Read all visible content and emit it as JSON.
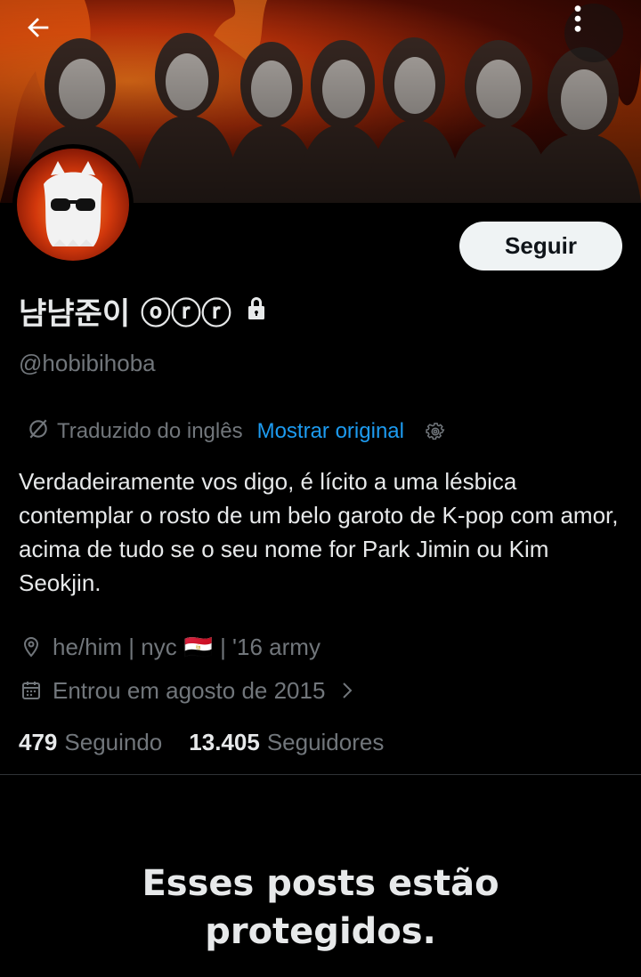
{
  "profile": {
    "display_name": "냠냠준이 ⓞⓡⓡ",
    "handle": "@hobibihoba",
    "follow_button_label": "Seguir",
    "locked": true
  },
  "translation": {
    "label": "Traduzido do inglês",
    "show_original_label": "Mostrar original"
  },
  "bio": "Verdadeiramente vos digo, é lícito a uma lésbica contemplar o rosto de um belo garoto de K-pop com amor, acima de tudo se o seu nome for Park Jimin ou Kim Seokjin.",
  "meta": {
    "location_prefix": "he/him | nyc",
    "location_flag": "🇪🇬",
    "location_suffix": "| '16 army",
    "joined": "Entrou em agosto de 2015"
  },
  "stats": {
    "following_count": "479",
    "following_label": "Seguindo",
    "followers_count": "13.405",
    "followers_label": "Seguidores"
  },
  "protected_message": "Esses posts estão protegidos.",
  "icons": {
    "back": "arrow-left-icon",
    "more": "more-vertical-icon",
    "lock": "lock-icon",
    "translate": "translate-icon",
    "settings": "gear-icon",
    "location": "location-pin-icon",
    "calendar": "calendar-icon",
    "chevron": "chevron-right-icon"
  },
  "colors": {
    "background": "#000000",
    "text_primary": "#e7e9ea",
    "text_secondary": "#71767b",
    "accent": "#1d9bf0",
    "divider": "#2f3336"
  }
}
